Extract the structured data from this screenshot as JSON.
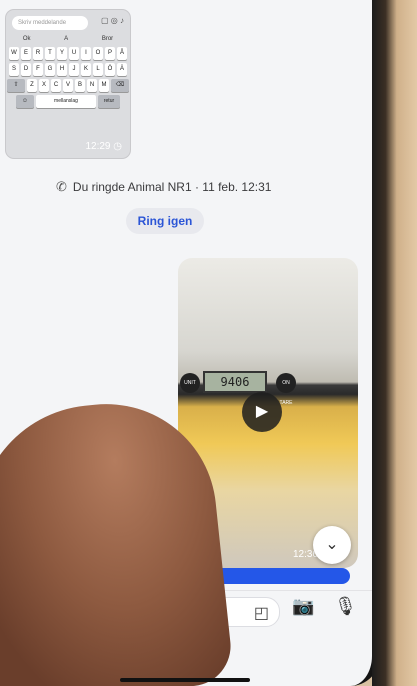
{
  "keyboard_screenshot": {
    "search_placeholder": "Skriv meddelande",
    "suggestions": [
      "Ok",
      "A",
      "Bror"
    ],
    "rows": [
      [
        "W",
        "E",
        "R",
        "T",
        "Y",
        "U",
        "I",
        "O",
        "P",
        "Å"
      ],
      [
        "S",
        "D",
        "F",
        "G",
        "H",
        "J",
        "K",
        "L",
        "Ö",
        "Ä"
      ],
      [
        "Z",
        "X",
        "C",
        "V",
        "B",
        "N",
        "M"
      ]
    ],
    "space_label": "mellanslag",
    "return_label": "retur",
    "time": "12:29"
  },
  "call_event": {
    "text": "Du ringde Animal NR1 · 11 feb. 12:31",
    "ring_again": "Ring igen"
  },
  "video_message": {
    "scale_value": "9406",
    "unit_label": "UNIT",
    "tare_label": "ON TARE",
    "time": "12:36"
  },
  "colors": {
    "accent": "#2b55d6",
    "sent_bubble": "#2457e8"
  },
  "icons": [
    "outgoing-call-icon",
    "play-icon",
    "chevron-down-icon",
    "sticker-icon",
    "camera-icon",
    "microphone-icon"
  ]
}
